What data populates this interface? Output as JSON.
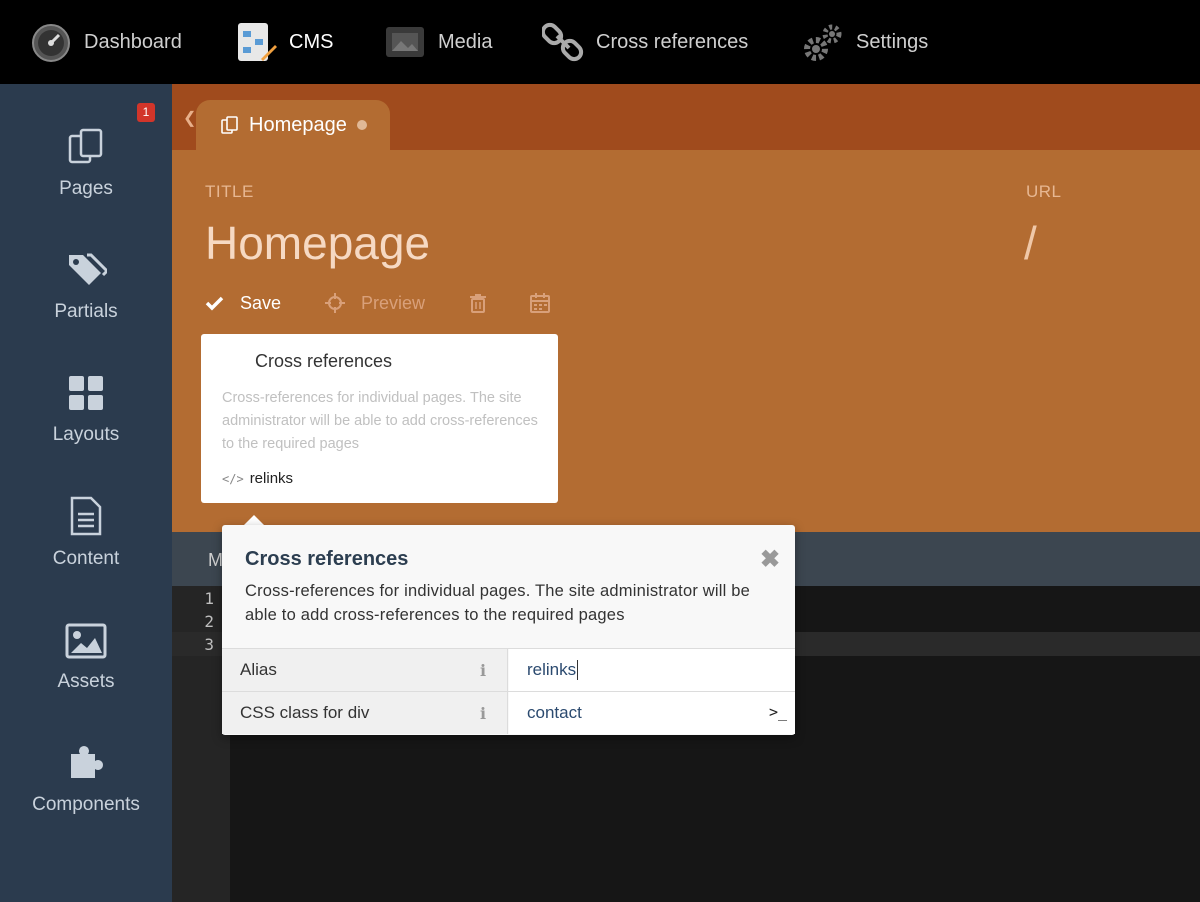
{
  "topnav": {
    "items": [
      {
        "label": "Dashboard",
        "icon": "dashboard-gauge-icon"
      },
      {
        "label": "CMS",
        "icon": "cms-icon",
        "active": true
      },
      {
        "label": "Media",
        "icon": "media-icon"
      },
      {
        "label": "Cross references",
        "icon": "chain-link-icon"
      },
      {
        "label": "Settings",
        "icon": "gears-icon"
      }
    ]
  },
  "sidebar": {
    "items": [
      {
        "label": "Pages",
        "icon": "pages-icon",
        "badge": "1"
      },
      {
        "label": "Partials",
        "icon": "tags-icon"
      },
      {
        "label": "Layouts",
        "icon": "layouts-grid-icon"
      },
      {
        "label": "Content",
        "icon": "document-icon"
      },
      {
        "label": "Assets",
        "icon": "image-icon"
      },
      {
        "label": "Components",
        "icon": "puzzle-icon"
      }
    ]
  },
  "tab": {
    "label": "Homepage"
  },
  "form": {
    "title_label": "TITLE",
    "title_value": "Homepage",
    "url_label": "URL",
    "url_value": "/"
  },
  "toolbar": {
    "save_label": "Save",
    "preview_label": "Preview"
  },
  "component_card": {
    "title": "Cross references",
    "description": "Cross-references for individual pages. The site administrator will be able to add cross-references to the required pages",
    "alias": "relinks"
  },
  "editor": {
    "header_partial": "M",
    "line_numbers": [
      "1",
      "2",
      "3"
    ]
  },
  "popup": {
    "title": "Cross references",
    "description": "Cross-references for individual pages. The site administrator will be able to add cross-references to the required pages",
    "properties": [
      {
        "name": "Alias",
        "value": "relinks"
      },
      {
        "name": "CSS class for div",
        "value": "contact"
      }
    ]
  },
  "colors": {
    "topnav_bg": "#000000",
    "sidebar_bg": "#2b3b4e",
    "header_orange": "#b36c32",
    "tabstrip": "#a04b1d",
    "badge": "#d2352a"
  }
}
